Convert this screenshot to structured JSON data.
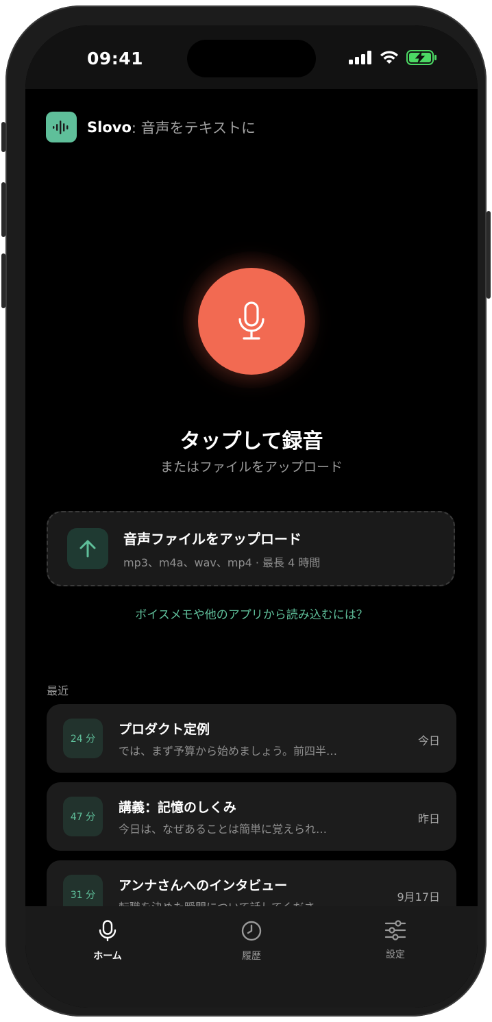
{
  "status_bar": {
    "time": "09:41"
  },
  "header": {
    "brand": "Slovo",
    "tagline": ": 音声をテキストに"
  },
  "record": {
    "title": "タップして録音",
    "subtitle": "またはファイルをアップロード"
  },
  "upload": {
    "title": "音声ファイルをアップロード",
    "subtitle": "mp3、m4a、wav、mp4 · 最長 4 時間"
  },
  "help_link": "ボイスメモや他のアプリから読み込むには？",
  "recent": {
    "label": "最近",
    "items": [
      {
        "duration": "24 分",
        "title": "プロダクト定例",
        "preview": "では、まず予算から始めましょう。前四半…",
        "date": "今日"
      },
      {
        "duration": "47 分",
        "title": "講義：記憶のしくみ",
        "preview": "今日は、なぜあることは簡単に覚えられ…",
        "date": "昨日"
      },
      {
        "duration": "31 分",
        "title": "アンナさんへのインタビュー",
        "preview": "転職を決めた瞬間について話してくださ…",
        "date": "9月17日"
      }
    ]
  },
  "tabs": [
    {
      "label": "ホーム",
      "icon": "mic-icon",
      "active": true
    },
    {
      "label": "履歴",
      "icon": "clock-icon",
      "active": false
    },
    {
      "label": "設定",
      "icon": "sliders-icon",
      "active": false
    }
  ],
  "colors": {
    "accent": "#5fbf9a",
    "record": "#f26a52",
    "background": "#000000"
  }
}
